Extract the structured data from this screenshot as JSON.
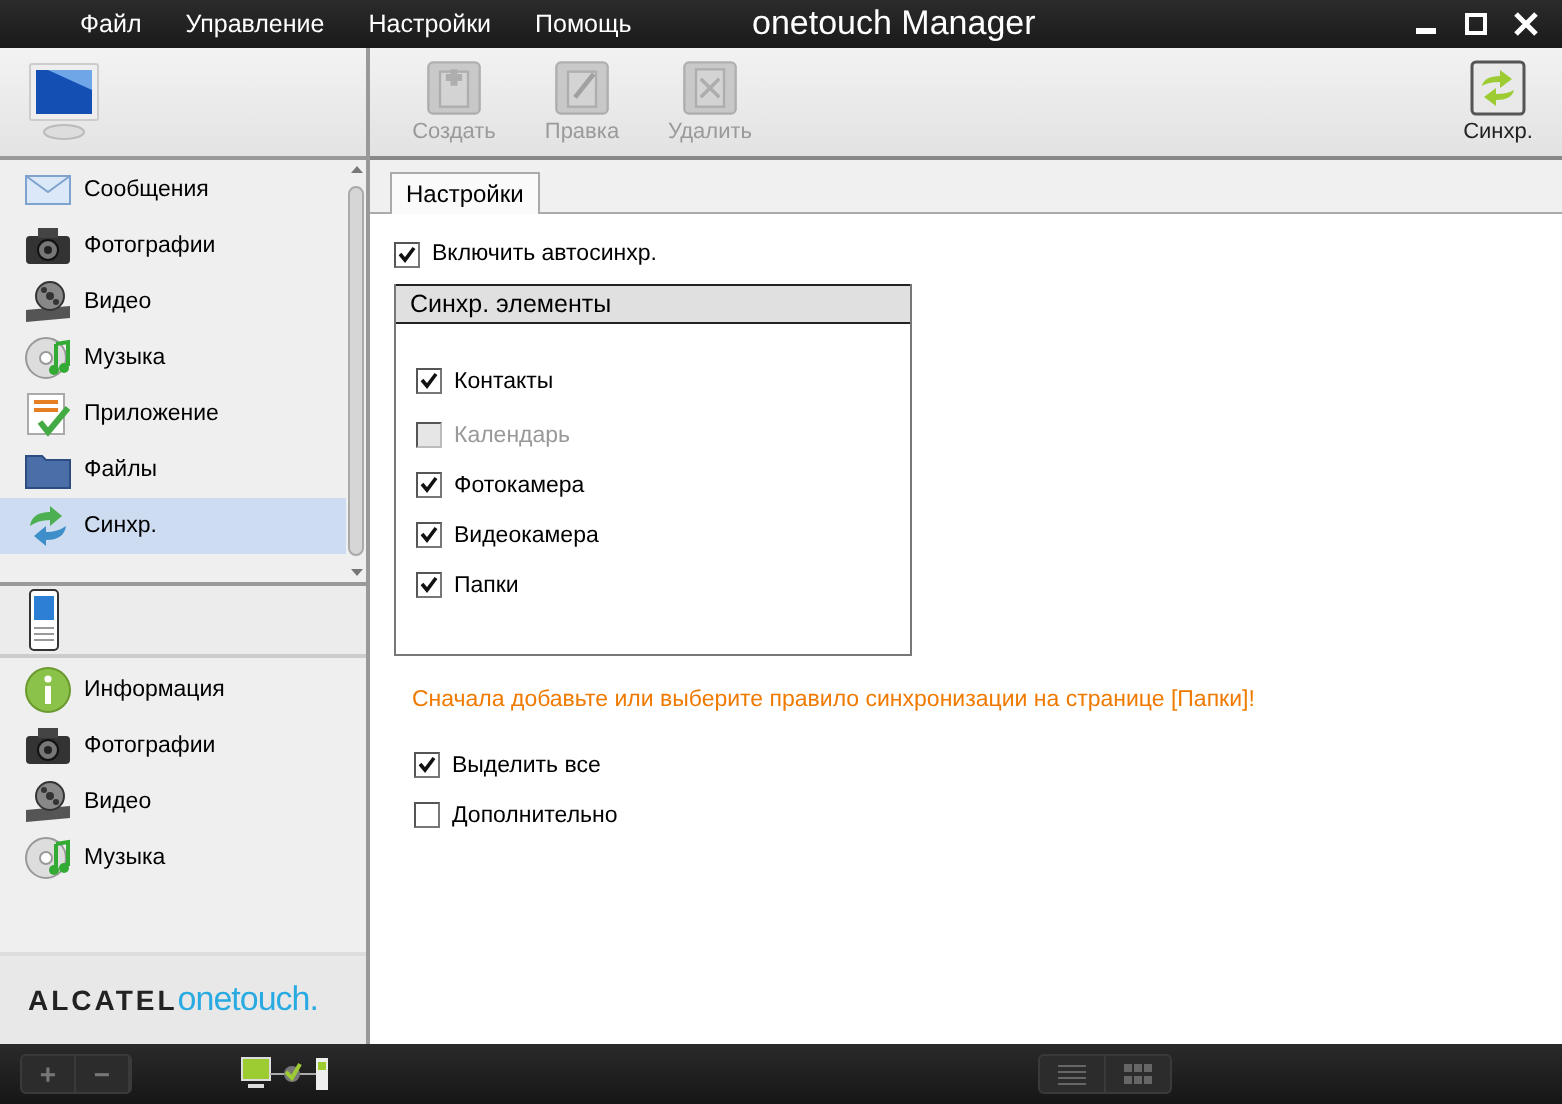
{
  "window": {
    "title": "onetouch Manager"
  },
  "menu": [
    {
      "label": "Файл"
    },
    {
      "label": "Управление"
    },
    {
      "label": "Настройки"
    },
    {
      "label": "Помощь"
    }
  ],
  "sidebar": {
    "computer_items": [
      {
        "label": "Сообщения",
        "kind": "messages",
        "selected": false
      },
      {
        "label": "Фотографии",
        "kind": "photos",
        "selected": false
      },
      {
        "label": "Видео",
        "kind": "video",
        "selected": false
      },
      {
        "label": "Музыка",
        "kind": "music",
        "selected": false
      },
      {
        "label": "Приложение",
        "kind": "apps",
        "selected": false
      },
      {
        "label": "Файлы",
        "kind": "files",
        "selected": false
      },
      {
        "label": "Синхр.",
        "kind": "sync",
        "selected": true
      }
    ],
    "phone_items": [
      {
        "label": "Информация",
        "kind": "info",
        "selected": false
      },
      {
        "label": "Фотографии",
        "kind": "photos",
        "selected": false
      },
      {
        "label": "Видео",
        "kind": "video",
        "selected": false
      },
      {
        "label": "Музыка",
        "kind": "music",
        "selected": false
      }
    ],
    "logo": {
      "brand": "ALCATEL",
      "product": "onetouch."
    }
  },
  "toolbar": {
    "buttons": [
      {
        "label": "Создать",
        "kind": "create",
        "disabled": true
      },
      {
        "label": "Правка",
        "kind": "edit",
        "disabled": true
      },
      {
        "label": "Удалить",
        "kind": "delete",
        "disabled": true
      }
    ],
    "sync_button": {
      "label": "Синхр.",
      "disabled": false
    }
  },
  "tabs": [
    {
      "label": "Настройки",
      "selected": true
    }
  ],
  "settings": {
    "auto_sync": {
      "label": "Включить автосинхр.",
      "checked": true
    },
    "sync_items": {
      "title": "Синхр. элементы",
      "items": [
        {
          "label": "Контакты",
          "checked": true,
          "disabled": false
        },
        {
          "label": "Календарь",
          "checked": false,
          "disabled": true
        },
        {
          "label": "Фотокамера",
          "checked": true,
          "disabled": false
        },
        {
          "label": "Видеокамера",
          "checked": true,
          "disabled": false
        },
        {
          "label": "Папки",
          "checked": true,
          "disabled": false
        }
      ]
    },
    "warning": "Сначала добавьте или выберите правило синхронизации на странице [Папки]!",
    "options": [
      {
        "label": "Выделить все",
        "checked": true
      },
      {
        "label": "Дополнительно",
        "checked": false
      }
    ]
  },
  "bottom_bar": {
    "buttons": [
      "+",
      "−"
    ]
  }
}
